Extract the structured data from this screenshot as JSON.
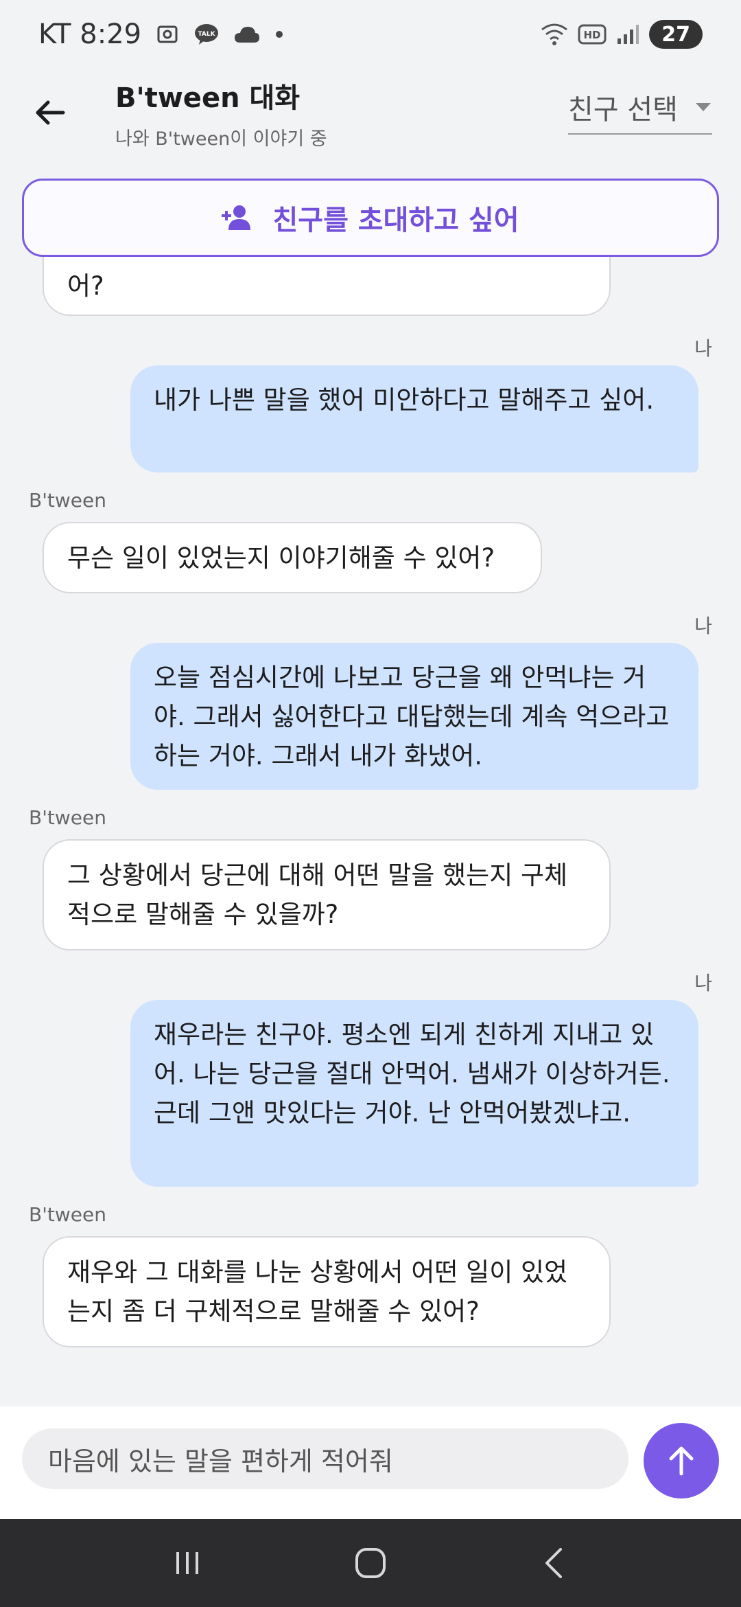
{
  "status_bar": {
    "carrier_time": "KT 8:29",
    "battery": "27",
    "icons": [
      "screenshot-icon",
      "talk-icon",
      "cloud-icon",
      "dot-icon",
      "wifi-icon",
      "hd-icon",
      "signal-icon"
    ]
  },
  "header": {
    "title": "B'tween 대화",
    "subtitle": "나와 B'tween이 이야기 중",
    "friend_select": "친구 선택"
  },
  "invite_button": {
    "label": "친구를 초대하고 싶어"
  },
  "messages": [
    {
      "sender": "bot",
      "sender_label": "",
      "text": "어?"
    },
    {
      "sender": "me",
      "sender_label": "나",
      "text": "내가 나쁜 말을 했어  미안하다고 말해주고 싶어."
    },
    {
      "sender": "bot",
      "sender_label": "B'tween",
      "text": "무슨 일이 있었는지 이야기해줄 수 있어?"
    },
    {
      "sender": "me",
      "sender_label": "나",
      "text": "오늘 점심시간에 나보고 당근을 왜 안먹냐는 거야. 그래서 싫어한다고 대답했는데 계속 억으라고 하는 거야. 그래서 내가 화냈어."
    },
    {
      "sender": "bot",
      "sender_label": "B'tween",
      "text": "그 상황에서 당근에 대해 어떤 말을 했는지 구체적으로 말해줄 수 있을까?"
    },
    {
      "sender": "me",
      "sender_label": "나",
      "text": "재우라는 친구야. 평소엔 되게 친하게 지내고 있어. 나는 당근을 절대 안먹어. 냄새가 이상하거든. 근데 그앤 맛있다는 거야. 난 안먹어봤겠냐고."
    },
    {
      "sender": "bot",
      "sender_label": "B'tween",
      "text": "재우와 그 대화를 나눈 상황에서 어떤 일이 있었는지 좀 더 구체적으로 말해줄 수 있어?"
    }
  ],
  "input": {
    "placeholder": "마음에 있는 말을 편하게 적어줘"
  },
  "colors": {
    "accent": "#7b5ae8",
    "me_bubble": "#cfe3fe",
    "bot_bubble": "#ffffff"
  }
}
